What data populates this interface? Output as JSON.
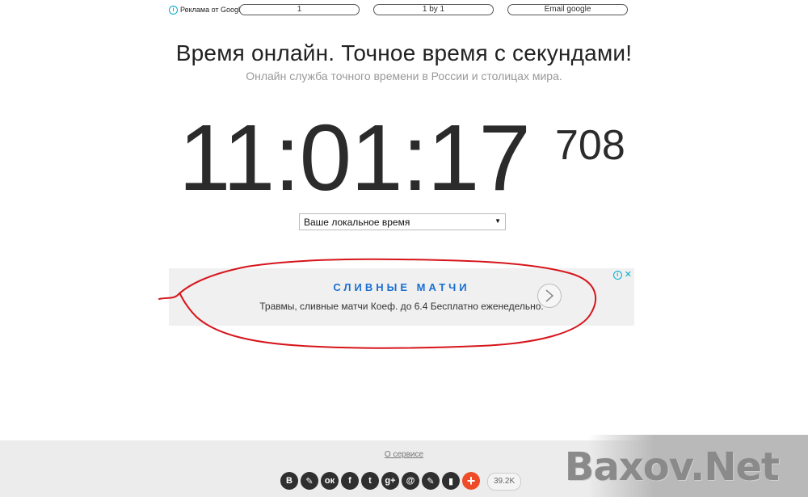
{
  "ad_strip": {
    "badge": "Реклама от Google",
    "links": [
      "1",
      "1 by 1",
      "Email google"
    ]
  },
  "header": {
    "title": "Время онлайн. Точное время с секундами!",
    "subtitle": "Онлайн служба точного времени в России и столицах мира."
  },
  "clock": {
    "time": "11:01:17",
    "milliseconds": "708"
  },
  "timezone_select": {
    "value": "Ваше локальное время",
    "caret": "▼"
  },
  "ad_banner": {
    "headline": "СЛИВНЫЕ МАТЧИ",
    "text": "Травмы, сливные матчи Коеф. до 6.4 Бесплатно еженедельно.",
    "close": "✕",
    "highlight_color": "#d6151b"
  },
  "footer": {
    "about_link": "О сервисе",
    "share_icons": [
      {
        "name": "vk-icon",
        "glyph": "B"
      },
      {
        "name": "livejournal-icon",
        "glyph": "✎"
      },
      {
        "name": "odnoklassniki-icon",
        "glyph": "ок"
      },
      {
        "name": "facebook-icon",
        "glyph": "f"
      },
      {
        "name": "twitter-icon",
        "glyph": "t"
      },
      {
        "name": "google-plus-icon",
        "glyph": "g+"
      },
      {
        "name": "mail-ru-icon",
        "glyph": "@"
      },
      {
        "name": "liveinternet-icon",
        "glyph": "✎"
      },
      {
        "name": "bookmark-icon",
        "glyph": "▮"
      },
      {
        "name": "more-icon",
        "glyph": "+"
      }
    ],
    "share_count": "39.2K"
  },
  "watermark": "Baxov.Net"
}
